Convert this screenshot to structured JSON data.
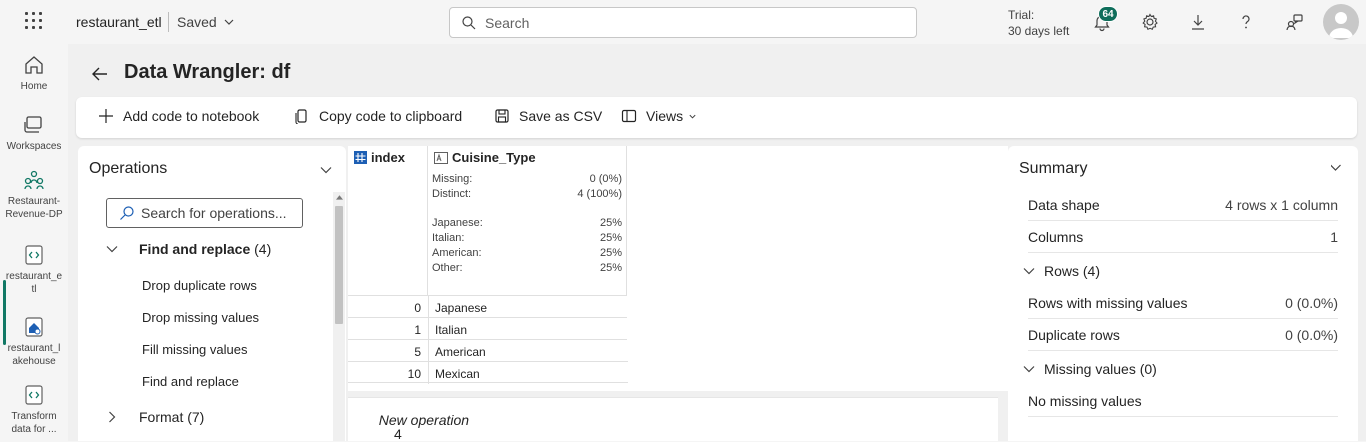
{
  "topbar": {
    "app_name": "restaurant_etl",
    "saved_label": "Saved",
    "search_placeholder": "Search",
    "trial_line1": "Trial:",
    "trial_line2": "30 days left",
    "notification_count": "64"
  },
  "leftnav": {
    "items": [
      {
        "label": "Home",
        "icon": "home-icon"
      },
      {
        "label": "Workspaces",
        "icon": "workspaces-icon"
      },
      {
        "label_lines": [
          "Restaurant-",
          "Revenue-DP"
        ],
        "icon": "workspace-group-icon"
      },
      {
        "label_lines": [
          "restaurant_e",
          "tl"
        ],
        "icon": "notebook-icon"
      },
      {
        "label_lines": [
          "restaurant_l",
          "akehouse"
        ],
        "icon": "lakehouse-icon"
      },
      {
        "label_lines": [
          "Transform",
          "data for ..."
        ],
        "icon": "notebook-icon"
      }
    ]
  },
  "page": {
    "title": "Data Wrangler: df"
  },
  "toolbar": {
    "add_code": "Add code to notebook",
    "copy_code": "Copy code to clipboard",
    "save_csv": "Save as CSV",
    "views": "Views"
  },
  "operations": {
    "title": "Operations",
    "search_placeholder": "Search for operations...",
    "groups": [
      {
        "label": "Find and replace",
        "count": "(4)",
        "expanded": true,
        "items": [
          "Drop duplicate rows",
          "Drop missing values",
          "Fill missing values",
          "Find and replace"
        ]
      },
      {
        "label": "Format",
        "count": "(7)",
        "expanded": false
      }
    ]
  },
  "grid": {
    "index_header": "index",
    "column_header": "Cuisine_Type",
    "stats": {
      "missing_label": "Missing:",
      "missing_value": "0 (0%)",
      "distinct_label": "Distinct:",
      "distinct_value": "4 (100%)",
      "top": [
        {
          "label": "Japanese:",
          "value": "25%"
        },
        {
          "label": "Italian:",
          "value": "25%"
        },
        {
          "label": "American:",
          "value": "25%"
        },
        {
          "label": "Other:",
          "value": "25%"
        }
      ]
    },
    "rows": [
      {
        "index": "0",
        "value": "Japanese"
      },
      {
        "index": "1",
        "value": "Italian"
      },
      {
        "index": "5",
        "value": "American"
      },
      {
        "index": "10",
        "value": "Mexican"
      }
    ]
  },
  "new_operation": {
    "number": "4",
    "label": "New operation"
  },
  "summary": {
    "title": "Summary",
    "rows": [
      {
        "key": "Data shape",
        "value": "4 rows x 1 column"
      },
      {
        "key": "Columns",
        "value": "1"
      }
    ],
    "rows_group": "Rows (4)",
    "rows_items": [
      {
        "key": "Rows with missing values",
        "value": "0 (0.0%)"
      },
      {
        "key": "Duplicate rows",
        "value": "0 (0.0%)"
      }
    ],
    "missing_group": "Missing values (0)",
    "missing_text": "No missing values"
  },
  "colors": {
    "accent": "#117865",
    "badge": "#0f6e5b"
  }
}
